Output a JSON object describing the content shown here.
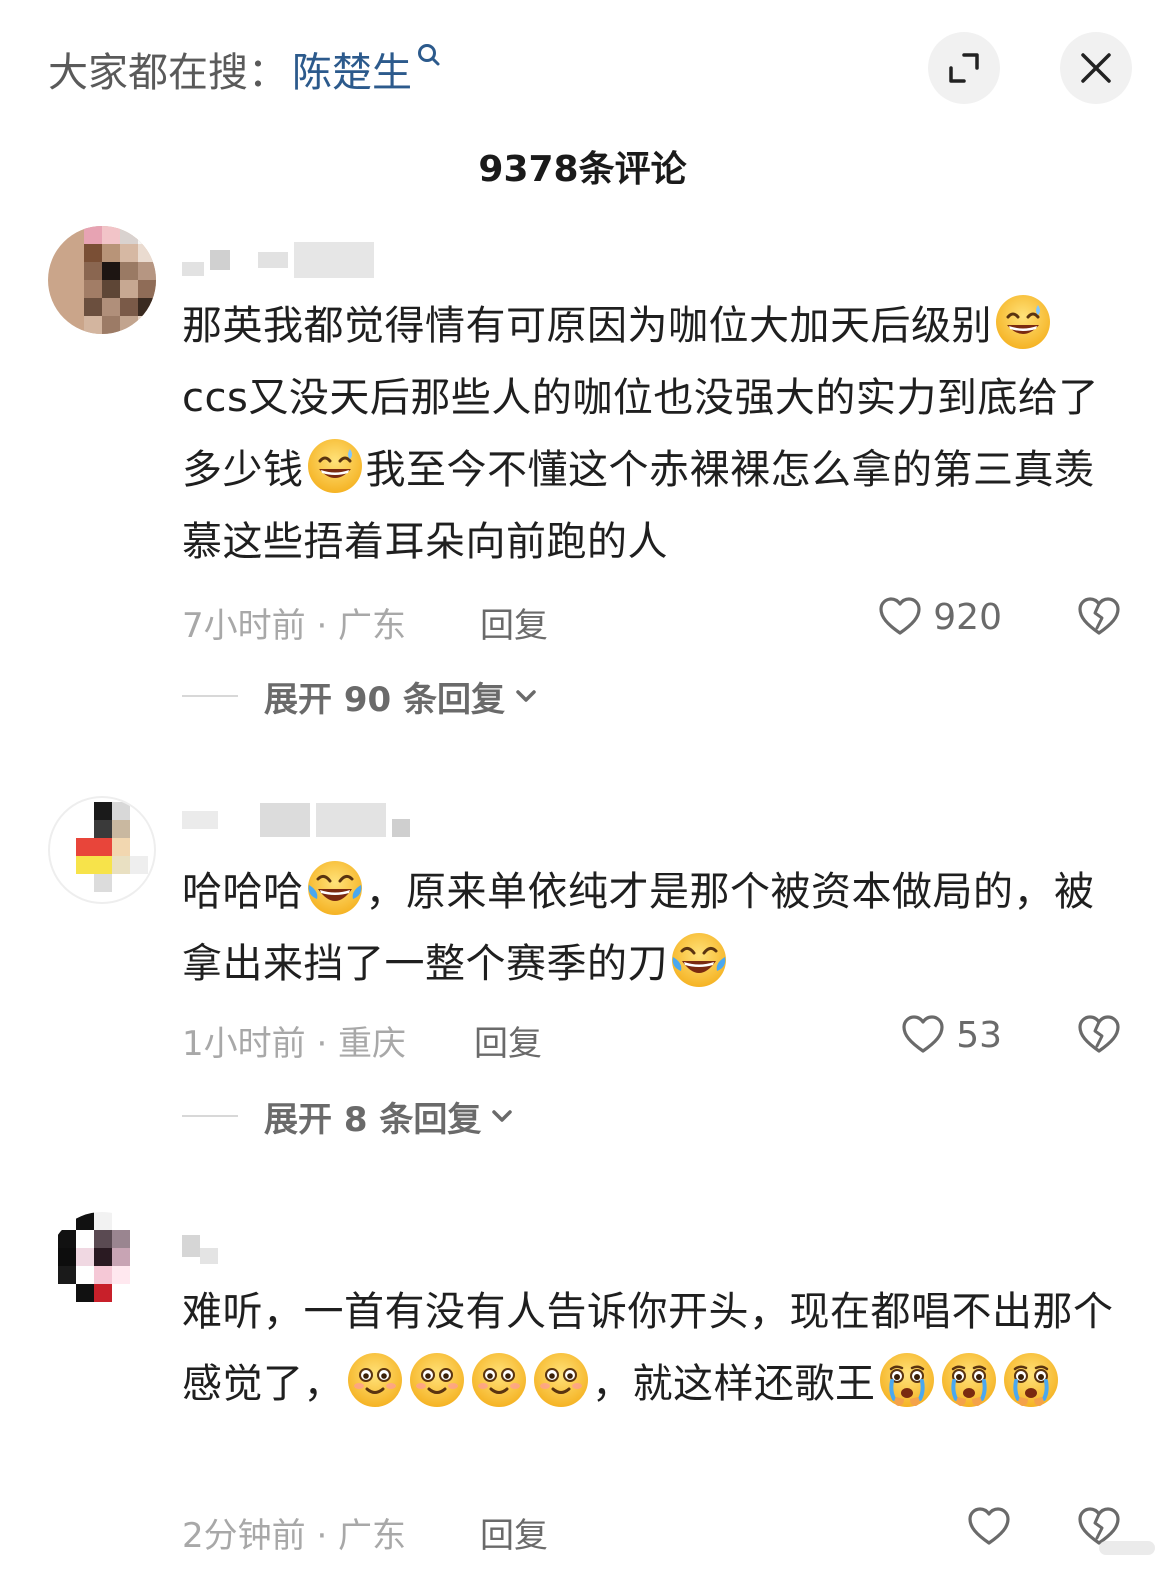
{
  "header": {
    "search_hint_label": "大家都在搜：",
    "search_term": "陈楚生"
  },
  "comments_count_label": "9378条评论",
  "colors": {
    "accent_link": "#2c5a8c",
    "muted": "#a8a8a8",
    "secondary": "#6a6a6a"
  },
  "comments": [
    {
      "text_parts": [
        "那英我都觉得情有可原因为咖位大加天后级别",
        "ccs又没天后那些人的咖位也没强大的实力到底给了多少钱",
        "我至今不懂这个赤裸裸怎么拿的第三真羡慕这些捂着耳朵向前跑的人"
      ],
      "emojis": [
        "grin-sweat-emoji",
        "grin-sweat-emoji"
      ],
      "time_location": "7小时前 · 广东",
      "reply_label": "回复",
      "like_count": "920",
      "expand_label": "展开 90 条回复"
    },
    {
      "text_parts": [
        "哈哈哈",
        "，原来单依纯才是那个被资本做局的，被拿出来挡了一整个赛季的刀"
      ],
      "emojis": [
        "rofl-emoji",
        "rofl-emoji"
      ],
      "time_location": "1小时前 · 重庆",
      "reply_label": "回复",
      "like_count": "53",
      "expand_label": "展开 8 条回复"
    },
    {
      "text_parts": [
        "难听，一首有没有人告诉你开头，现在都唱不出那个感觉了，",
        "，就这样还歌王"
      ],
      "emojis": [
        "smile-emoji",
        "smile-emoji",
        "smile-emoji",
        "smile-emoji",
        "crying-emoji",
        "crying-emoji",
        "crying-emoji"
      ],
      "time_location": "2分钟前 · 广东",
      "reply_label": "回复",
      "like_count": ""
    }
  ]
}
